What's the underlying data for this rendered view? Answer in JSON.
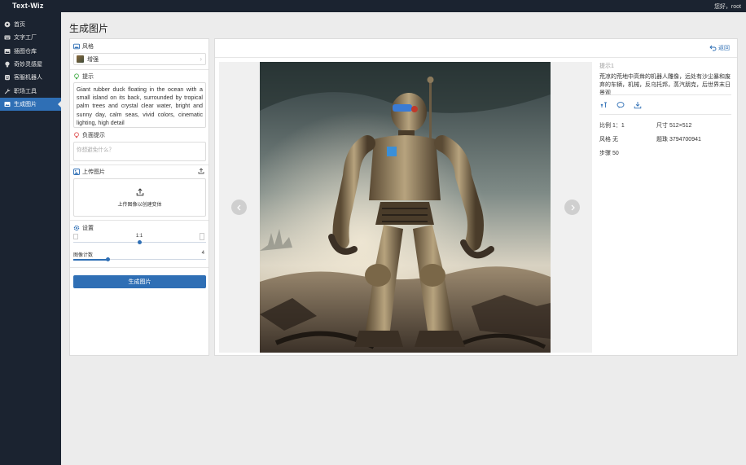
{
  "app": {
    "brand": "Text-Wiz",
    "greeting": "您好，root"
  },
  "sidebar": {
    "items": [
      {
        "label": "首页",
        "icon": "home-icon"
      },
      {
        "label": "文字工厂",
        "icon": "keyboard-icon"
      },
      {
        "label": "插图仓库",
        "icon": "image-icon"
      },
      {
        "label": "奇妙灵感屋",
        "icon": "bulb-icon"
      },
      {
        "label": "客服机器人",
        "icon": "robot-icon"
      },
      {
        "label": "职场工具",
        "icon": "wrench-icon"
      },
      {
        "label": "生成图片",
        "icon": "picture-icon",
        "active": true
      }
    ]
  },
  "page": {
    "title": "生成图片"
  },
  "form": {
    "style_label": "风格",
    "style_value": "增强",
    "prompt_label": "提示",
    "prompt_value": "Giant rubber duck floating in the ocean with a small island on its back, surrounded by tropical palm trees and crystal clear water, bright and sunny day, calm seas, vivid colors, cinematic lighting, high detail",
    "negative_label": "负面提示",
    "negative_placeholder": "你想避免什么？",
    "upload_label": "上传图片",
    "upload_hint": "上传图像以创建变体",
    "settings_label": "设置",
    "ratio_value": "1:1",
    "ratio_level": 0.5,
    "count_label": "图像计数",
    "count_value": "4",
    "count_level": 0.26,
    "generate_button": "生成图片"
  },
  "result": {
    "back_label": "返回",
    "prompt_label": "提示1",
    "prompt_text": "荒凉的荒地中高耸的机器人雕像，远处有沙尘暴和废弃的车辆，机械，反乌托邦，蒸汽朋克，后世界末日景观",
    "ratio": "比例 1：1",
    "size": "尺寸 512×512",
    "style": "风格 无",
    "seed": "题珠 3794700941",
    "steps": "步骤 50"
  },
  "colors": {
    "accent": "#2f6fb5",
    "sidebar_bg": "#1b2330",
    "page_bg": "#ececec"
  }
}
